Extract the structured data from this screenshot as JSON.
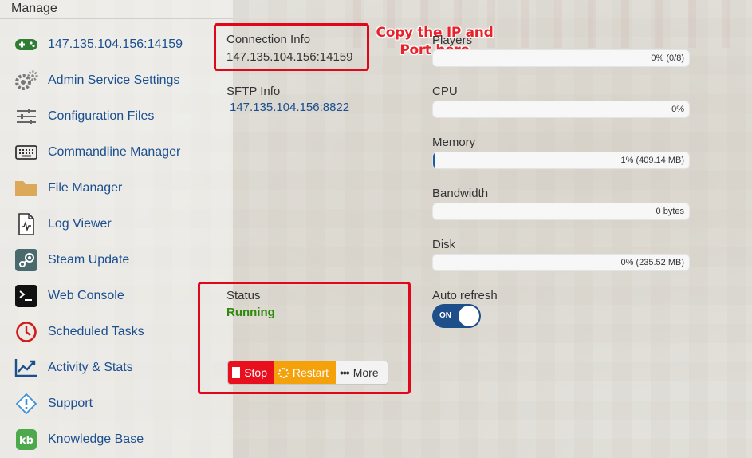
{
  "sidebar": {
    "header": "Manage",
    "items": [
      {
        "label": "147.135.104.156:14159",
        "icon": "gamepad-icon"
      },
      {
        "label": "Admin Service Settings",
        "icon": "gears-icon"
      },
      {
        "label": "Configuration Files",
        "icon": "sliders-icon"
      },
      {
        "label": "Commandline Manager",
        "icon": "keyboard-icon"
      },
      {
        "label": "File Manager",
        "icon": "folder-icon"
      },
      {
        "label": "Log Viewer",
        "icon": "log-file-icon"
      },
      {
        "label": "Steam Update",
        "icon": "steam-icon"
      },
      {
        "label": "Web Console",
        "icon": "terminal-icon"
      },
      {
        "label": "Scheduled Tasks",
        "icon": "clock-icon"
      },
      {
        "label": "Activity & Stats",
        "icon": "chart-icon"
      },
      {
        "label": "Support",
        "icon": "alert-icon"
      },
      {
        "label": "Knowledge Base",
        "icon": "kb-icon"
      }
    ]
  },
  "connection": {
    "label": "Connection Info",
    "value": "147.135.104.156:14159"
  },
  "sftp": {
    "label": "SFTP Info",
    "value": "147.135.104.156:8822"
  },
  "annotation": {
    "line1": "Copy the IP and",
    "line2": "Port here",
    "color": "#e8222a"
  },
  "status": {
    "label": "Status",
    "value": "Running",
    "value_color": "#2e8a0c"
  },
  "actions": {
    "stop": "Stop",
    "restart": "Restart",
    "more": "More"
  },
  "stats": {
    "players": {
      "label": "Players",
      "text": "0% (0/8)",
      "fraction": 0.0
    },
    "cpu": {
      "label": "CPU",
      "text": "0%",
      "fraction": 0.0
    },
    "memory": {
      "label": "Memory",
      "text": "1% (409.14 MB)",
      "fraction": 0.01
    },
    "bandwidth": {
      "label": "Bandwidth",
      "text": "0 bytes",
      "fraction": 0.0
    },
    "disk": {
      "label": "Disk",
      "text": "0% (235.52 MB)",
      "fraction": 0.0
    }
  },
  "auto_refresh": {
    "label": "Auto refresh",
    "state": "ON"
  },
  "colors": {
    "accent": "#1b4f8f",
    "stop": "#e8101e",
    "restart": "#f4a10c",
    "highlight": "#e2061a"
  }
}
